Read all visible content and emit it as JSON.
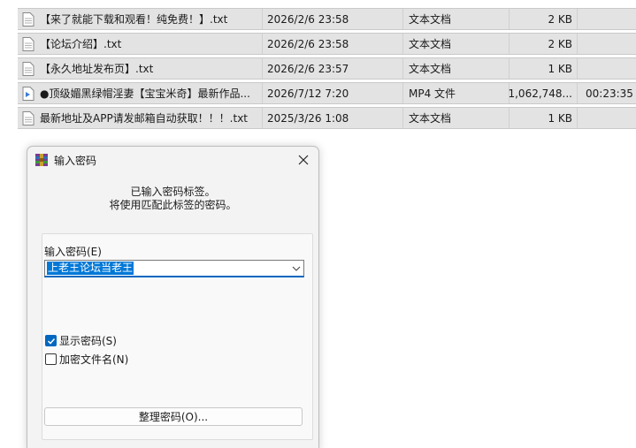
{
  "files": [
    {
      "icon": "text-file-icon",
      "name": "【来了就能下载和观看！纯免费！】.txt",
      "date": "2026/2/6 23:58",
      "type": "文本文档",
      "size": "2 KB",
      "duration": ""
    },
    {
      "icon": "text-file-icon",
      "name": "【论坛介绍】.txt",
      "date": "2026/2/6 23:58",
      "type": "文本文档",
      "size": "2 KB",
      "duration": ""
    },
    {
      "icon": "text-file-icon",
      "name": "【永久地址发布页】.txt",
      "date": "2026/2/6 23:57",
      "type": "文本文档",
      "size": "1 KB",
      "duration": ""
    },
    {
      "icon": "video-file-icon",
      "name": "●顶级媚黑绿帽淫妻【宝宝米奇】最新作品...",
      "date": "2026/7/12 7:20",
      "type": "MP4 文件",
      "size": "1,062,748...",
      "duration": "00:23:35"
    },
    {
      "icon": "text-file-icon",
      "name": "最新地址及APP请发邮箱自动获取！！！.txt",
      "date": "2025/3/26 1:08",
      "type": "文本文档",
      "size": "1 KB",
      "duration": ""
    }
  ],
  "dialog": {
    "title": "输入密码",
    "message_line1": "已输入密码标签。",
    "message_line2": "将使用匹配此标签的密码。",
    "password_label": "输入密码(E)",
    "password_value": "上老王论坛当老王",
    "show_password_label": "显示密码(S)",
    "show_password_checked": true,
    "encrypt_names_label": "加密文件名(N)",
    "encrypt_names_checked": false,
    "organize_button": "整理密码(O)..."
  },
  "colors": {
    "accent": "#0067c0",
    "selection": "#0078d7",
    "row_bg": "#e3e3e3"
  }
}
